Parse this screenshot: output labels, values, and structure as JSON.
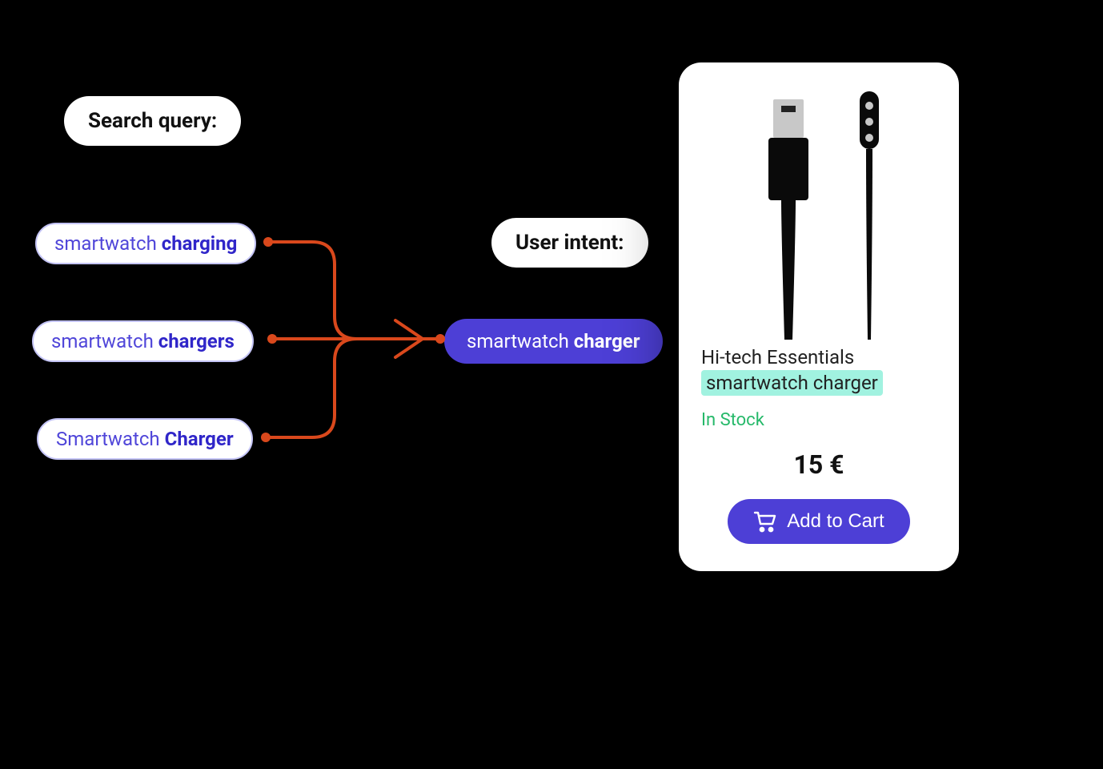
{
  "labels": {
    "search_query": "Search query:",
    "user_intent": "User intent:"
  },
  "queries": [
    {
      "prefix": "smartwatch ",
      "bold": "charging"
    },
    {
      "prefix": "smartwatch ",
      "bold": "chargers"
    },
    {
      "prefix": "Smartwatch ",
      "bold": "Charger"
    }
  ],
  "intent": {
    "prefix": "smartwatch ",
    "bold": "charger"
  },
  "product": {
    "title": "Hi-tech Essentials",
    "highlight": "smartwatch charger",
    "stock": "In Stock",
    "price": "15 €",
    "cart_label": "Add to Cart"
  },
  "colors": {
    "connector": "#d9481c",
    "primary": "#4d3fd6",
    "highlight": "#a1f2e0",
    "stock": "#26b96a"
  }
}
